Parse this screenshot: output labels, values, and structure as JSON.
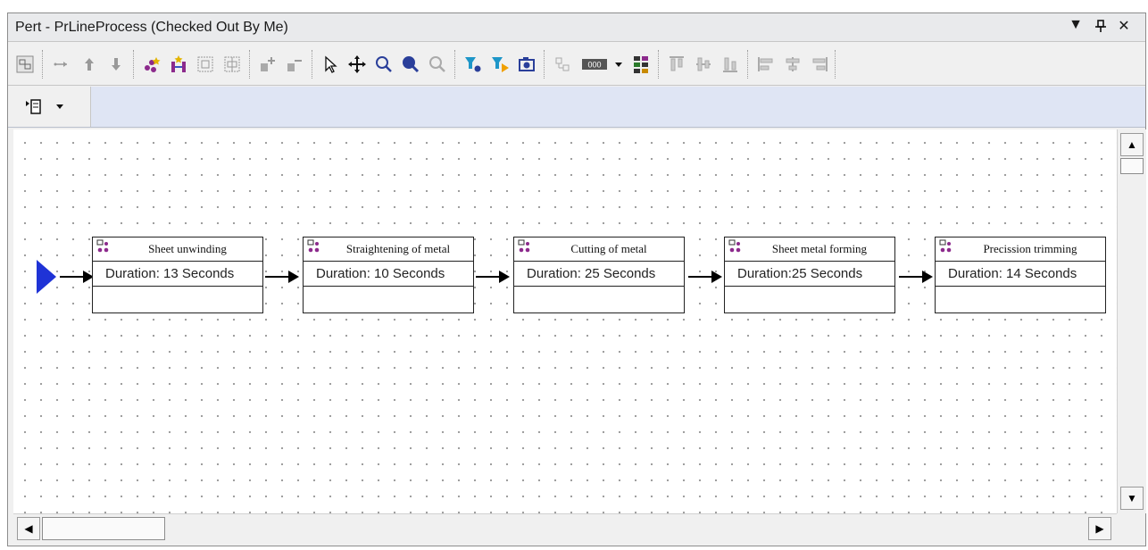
{
  "window": {
    "title": "Pert - PrLineProcess (Checked Out By Me)",
    "controls": [
      "▼",
      "ᚁ",
      "✕"
    ]
  },
  "toolbar": {
    "buttons": [
      "layout-view-icon",
      "link-icon",
      "move-up-icon",
      "move-down-icon",
      "new-node-icon",
      "new-chain-icon",
      "frame-icon",
      "frame-split-icon",
      "add-attribute-icon",
      "remove-attribute-icon",
      "select-pointer-icon",
      "pan-icon",
      "zoom-icon",
      "zoom-fit-icon",
      "zoom-reset-icon",
      "filter-icon",
      "filter-apply-icon",
      "camera-icon",
      "align-icon",
      "counter-icon",
      "dropdown-icon",
      "grid-icon",
      "align-top-icon",
      "align-middle-icon",
      "align-bottom-icon",
      "align-left-icon",
      "align-center-icon",
      "align-right-icon"
    ]
  },
  "toolbar2": {
    "view_menu_icon": "view-menu-icon",
    "dropdown_icon": "chevron-down-icon"
  },
  "diagram": {
    "start_color": "#1f33d6",
    "nodes": [
      {
        "name": "Sheet unwinding",
        "duration": "Duration: 13 Seconds"
      },
      {
        "name": "Straightening of metal",
        "duration": "Duration: 10 Seconds"
      },
      {
        "name": "Cutting of metal",
        "duration": "Duration: 25 Seconds"
      },
      {
        "name": "Sheet metal forming",
        "duration": "Duration:25  Seconds"
      },
      {
        "name": "Precission trimming",
        "duration": "Duration: 14 Seconds"
      }
    ]
  },
  "scrollbars": {
    "up": "▲",
    "down": "▼",
    "left": "◀",
    "right": "▶"
  }
}
